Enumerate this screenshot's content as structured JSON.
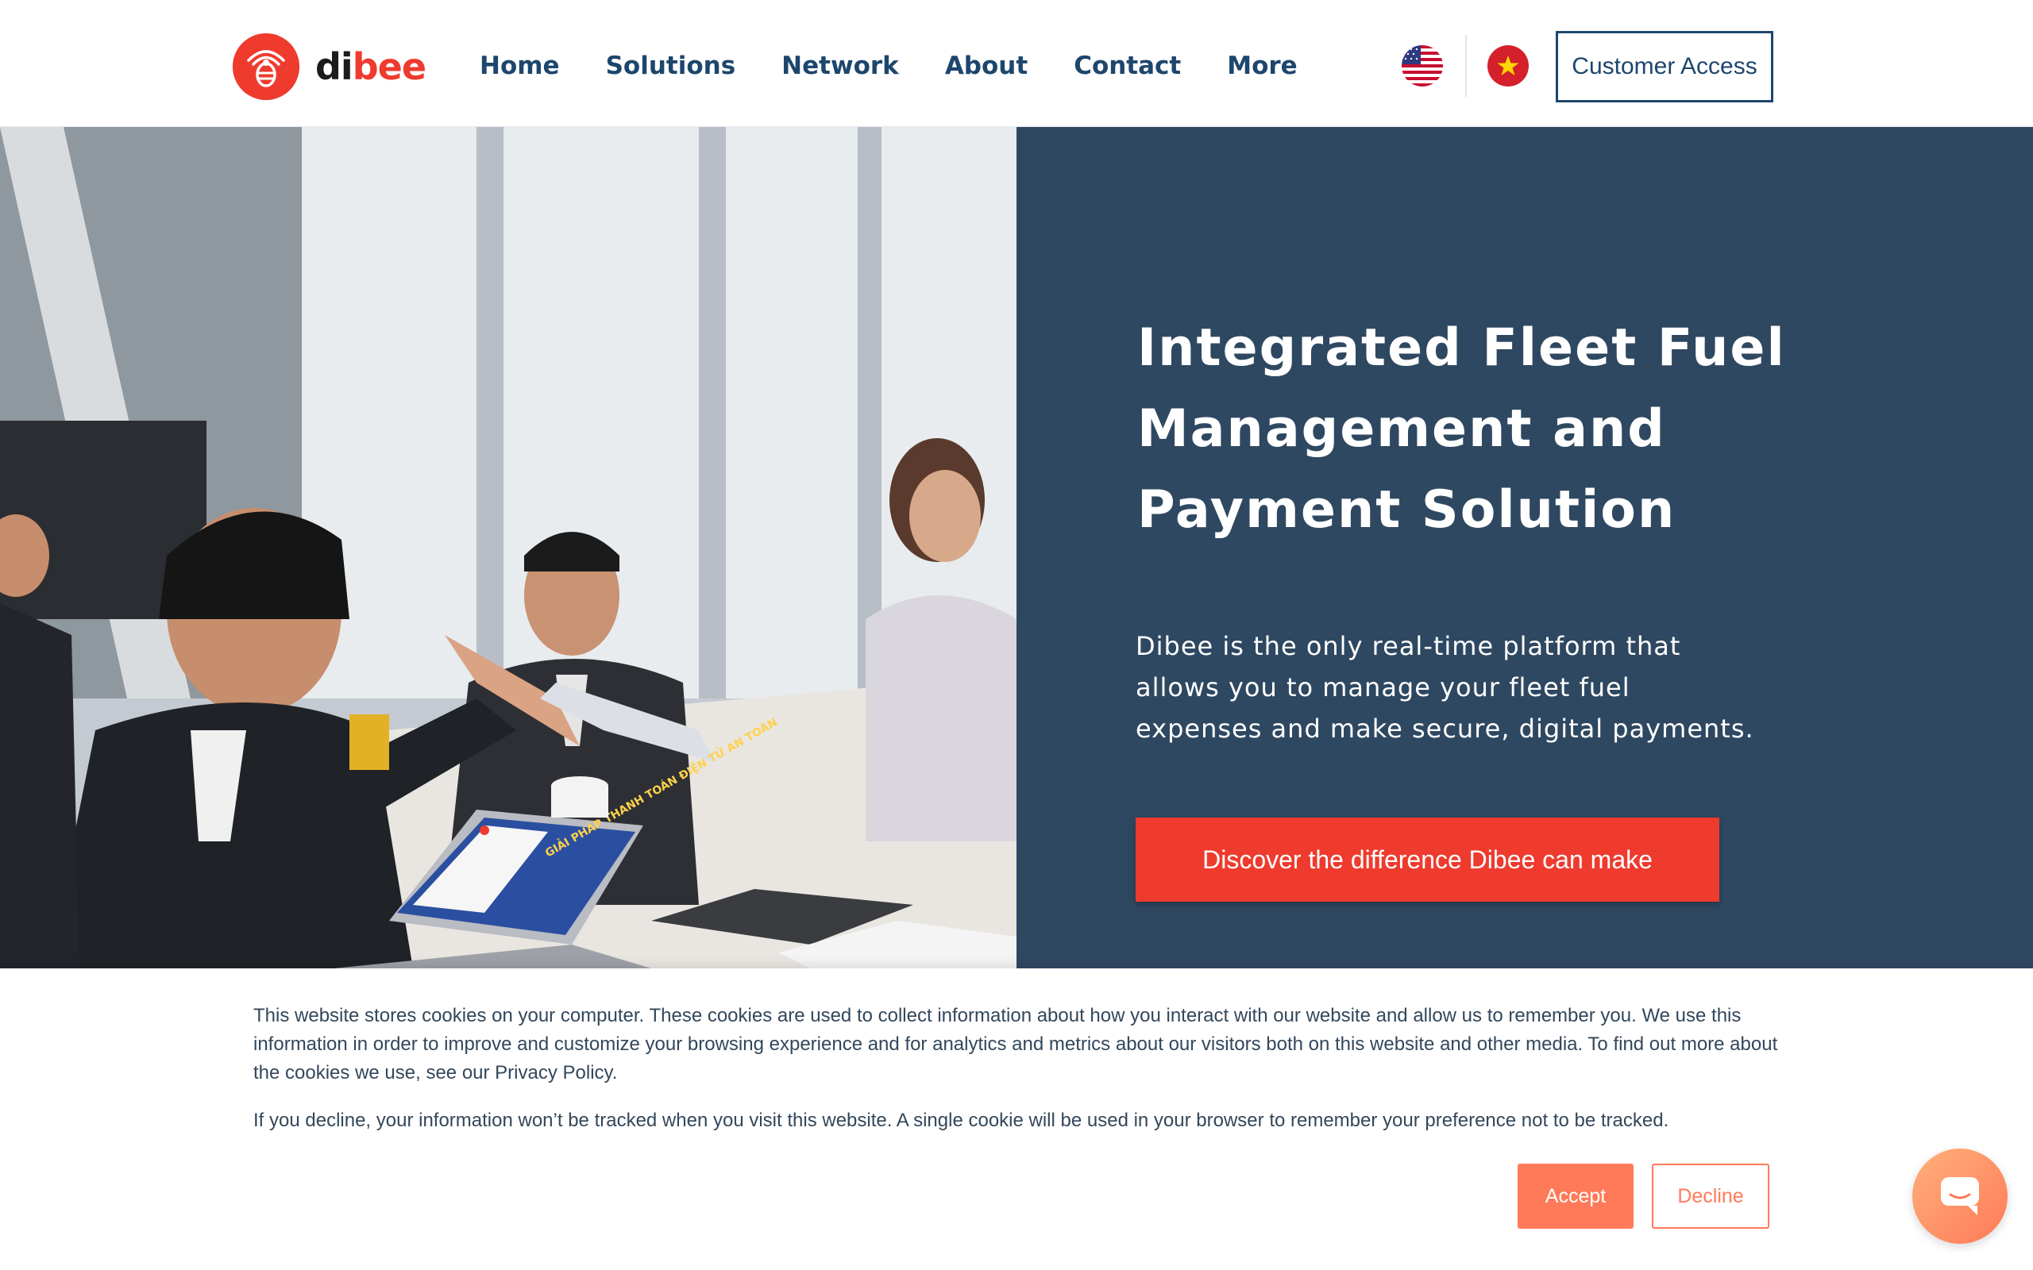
{
  "brand": {
    "logo_prefix": "di",
    "logo_suffix": "bee"
  },
  "nav": {
    "items": [
      {
        "label": "Home"
      },
      {
        "label": "Solutions"
      },
      {
        "label": "Network"
      },
      {
        "label": "About"
      },
      {
        "label": "Contact"
      },
      {
        "label": "More"
      }
    ],
    "customer_access": "Customer Access",
    "languages": [
      "English (US flag)",
      "Vietnamese (VN flag)"
    ]
  },
  "hero": {
    "title": "Integrated Fleet Fuel Management and Payment Solution",
    "subtitle": "Dibee is the only real-time platform that allows you to manage your fleet fuel expenses and make secure, digital payments.",
    "cta": "Discover the difference Dibee can make",
    "laptop_screen_text": "GIẢI PHÁP THANH TOÁN ĐIỆN TỬ AN TOÀN"
  },
  "cookie_banner": {
    "paragraph1": "This website stores cookies on your computer. These cookies are used to collect information about how you interact with our website and allow us to remember you. We use this information in order to improve and customize your browsing experience and for analytics and metrics about our visitors both on this website and other media. To find out more about the cookies we use, see our Privacy Policy.",
    "paragraph2": "If you decline, your information won’t be tracked when you visit this website. A single cookie will be used in your browser to remember your preference not to be tracked.",
    "accept": "Accept",
    "decline": "Decline"
  },
  "colors": {
    "brand_red": "#ee3b2e",
    "navy": "#1d466d",
    "hero_panel": "#2f4861",
    "cookie_accent": "#ff7a59"
  },
  "icons": [
    "bee-logo-icon",
    "us-flag-icon",
    "vn-flag-icon",
    "chat-icon"
  ]
}
